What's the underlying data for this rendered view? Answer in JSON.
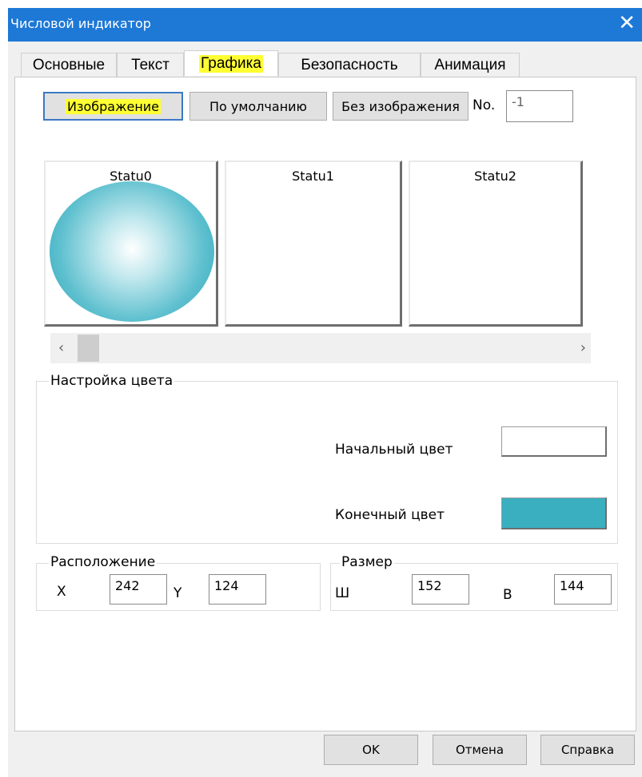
{
  "window": {
    "title": "Числовой индикатор"
  },
  "tabs": [
    {
      "label": "Основные"
    },
    {
      "label": "Текст"
    },
    {
      "label": "Графика"
    },
    {
      "label": "Безопасность"
    },
    {
      "label": "Анимация"
    }
  ],
  "image_buttons": {
    "image": "Изображение",
    "default": "По умолчанию",
    "no_image": "Без изображения",
    "no_label": "No.",
    "no_value": "-1"
  },
  "states": [
    {
      "label": "Statu0"
    },
    {
      "label": "Statu1"
    },
    {
      "label": "Statu2"
    }
  ],
  "color_settings": {
    "title": "Настройка цвета",
    "start_label": "Начальный цвет",
    "start_color": "#ffffff",
    "end_label": "Конечный цвет",
    "end_color": "#3aafc0"
  },
  "position": {
    "title": "Расположение",
    "x_label": "X",
    "x_value": "242",
    "y_label": "Y",
    "y_value": "124"
  },
  "size": {
    "title": "Размер",
    "w_label": "Ш",
    "w_value": "152",
    "h_label": "В",
    "h_value": "144"
  },
  "footer": {
    "ok": "OK",
    "cancel": "Отмена",
    "help": "Справка"
  }
}
